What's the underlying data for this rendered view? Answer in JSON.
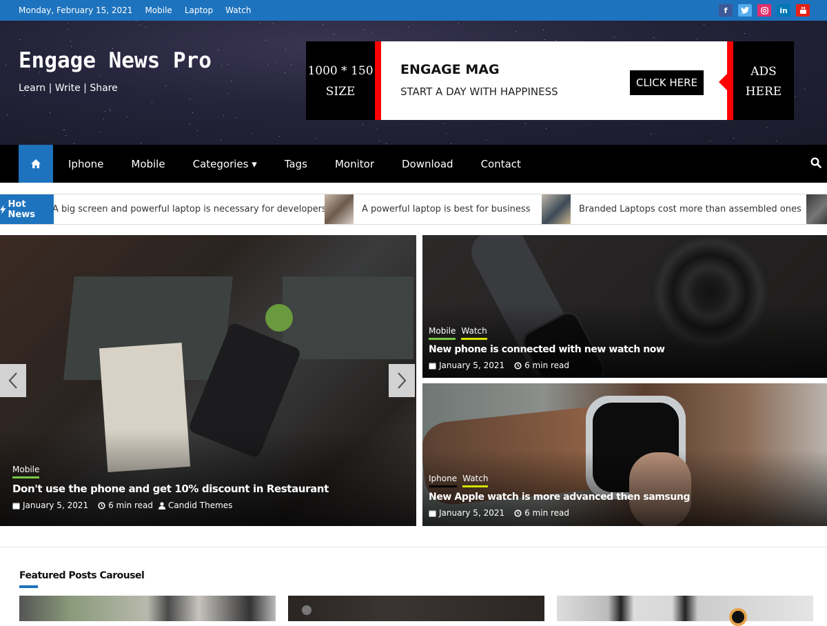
{
  "topbar": {
    "date": "Monday, February 15, 2021",
    "links": [
      "Mobile",
      "Laptop",
      "Watch"
    ],
    "social": [
      {
        "name": "facebook",
        "glyph": "f",
        "color": "#3b5998"
      },
      {
        "name": "twitter",
        "glyph": "t",
        "color": "#55acee"
      },
      {
        "name": "instagram",
        "glyph": "◎",
        "color": "#e1306c"
      },
      {
        "name": "linkedin",
        "glyph": "in",
        "color": "#0077b5"
      },
      {
        "name": "youtube",
        "glyph": "▶",
        "color": "#e62117"
      }
    ]
  },
  "header": {
    "site_title": "Engage News Pro",
    "tagline": "Learn | Write | Share"
  },
  "ad": {
    "size_line1": "1000 * 150",
    "size_line2": "SIZE",
    "heading": "ENGAGE MAG",
    "subheading": "START A DAY WITH HAPPINESS",
    "button": "CLICK HERE",
    "right_line1": "ADS",
    "right_line2": "HERE"
  },
  "nav": {
    "items": [
      "Iphone",
      "Mobile",
      "Categories ▾",
      "Tags",
      "Monitor",
      "Download",
      "Contact"
    ]
  },
  "ticker": {
    "label": "Hot News",
    "items": [
      "A big screen and powerful laptop is necessary for developers",
      "A powerful laptop is best for business",
      "Branded Laptops cost more than assembled ones"
    ]
  },
  "slider": {
    "prev": "‹",
    "next": "›",
    "post": {
      "categories": [
        "Mobile"
      ],
      "title": "Don't use the phone and get 10% discount in Restaurant",
      "date": "January 5, 2021",
      "read_time": "6 min read",
      "author": "Candid Themes"
    }
  },
  "side_posts": [
    {
      "categories": [
        "Mobile",
        "Watch"
      ],
      "title": "New phone is connected with new watch now",
      "date": "January 5, 2021",
      "read_time": "6 min read"
    },
    {
      "categories": [
        "Iphone",
        "Watch"
      ],
      "title": "New Apple watch is more advanced then samsung",
      "date": "January 5, 2021",
      "read_time": "6 min read"
    }
  ],
  "category_colors": {
    "Mobile": "#7ac943",
    "Watch": "#d4e300",
    "Iphone": "#000000"
  },
  "featured": {
    "title": "Featured Posts Carousel"
  },
  "colors": {
    "accent": "#1e73be",
    "ad_red": "#ff0000"
  }
}
